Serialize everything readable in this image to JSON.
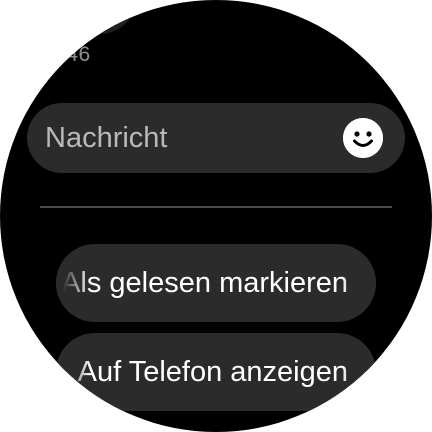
{
  "conversation": {
    "timestamp": ":46"
  },
  "reply": {
    "placeholder": "Nachricht",
    "emoji_icon": "smiley-face-icon"
  },
  "actions": [
    {
      "label": "Als gelesen markieren"
    },
    {
      "label": "Auf Telefon anzeigen"
    }
  ],
  "colors": {
    "background": "#000000",
    "pill": "#2b2b2b",
    "text_primary": "#ffffff",
    "text_secondary": "#b9b9b9",
    "divider": "#4a4a4a"
  }
}
